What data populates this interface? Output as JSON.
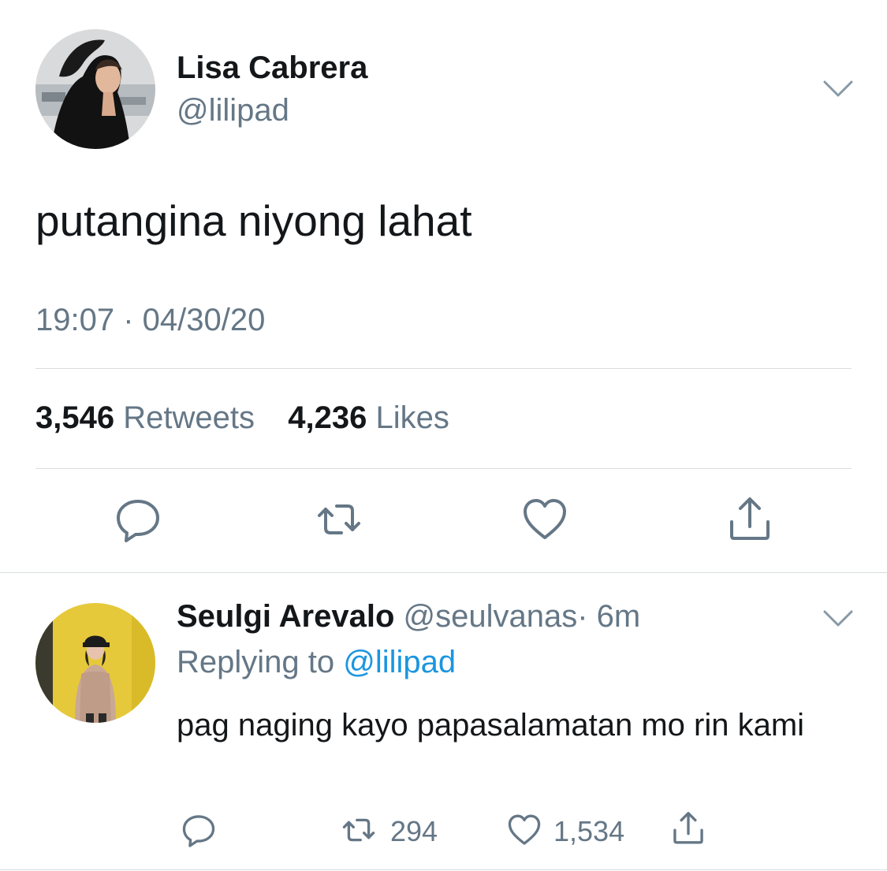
{
  "tweet": {
    "author": {
      "name": "Lisa Cabrera",
      "handle": "@lilipad"
    },
    "text": "putangina niyong lahat",
    "timestamp": "19:07 · 04/30/20",
    "stats": {
      "retweets_count": "3,546",
      "retweets_label": "Retweets",
      "likes_count": "4,236",
      "likes_label": "Likes"
    },
    "actions": [
      "reply-icon",
      "retweet-icon",
      "like-icon",
      "share-icon"
    ]
  },
  "reply": {
    "author": {
      "name": "Seulgi Arevalo",
      "handle": "@seulvanas",
      "time": "· 6m"
    },
    "replying_label": "Replying to",
    "replying_to": "@lilipad",
    "text": "pag naging kayo papasalamatan mo rin kami",
    "actions": {
      "retweets": "294",
      "likes": "1,534"
    }
  },
  "colors": {
    "text_primary": "#14171a",
    "text_secondary": "#657786",
    "link": "#1b95e0",
    "divider": "#d8dde1"
  }
}
